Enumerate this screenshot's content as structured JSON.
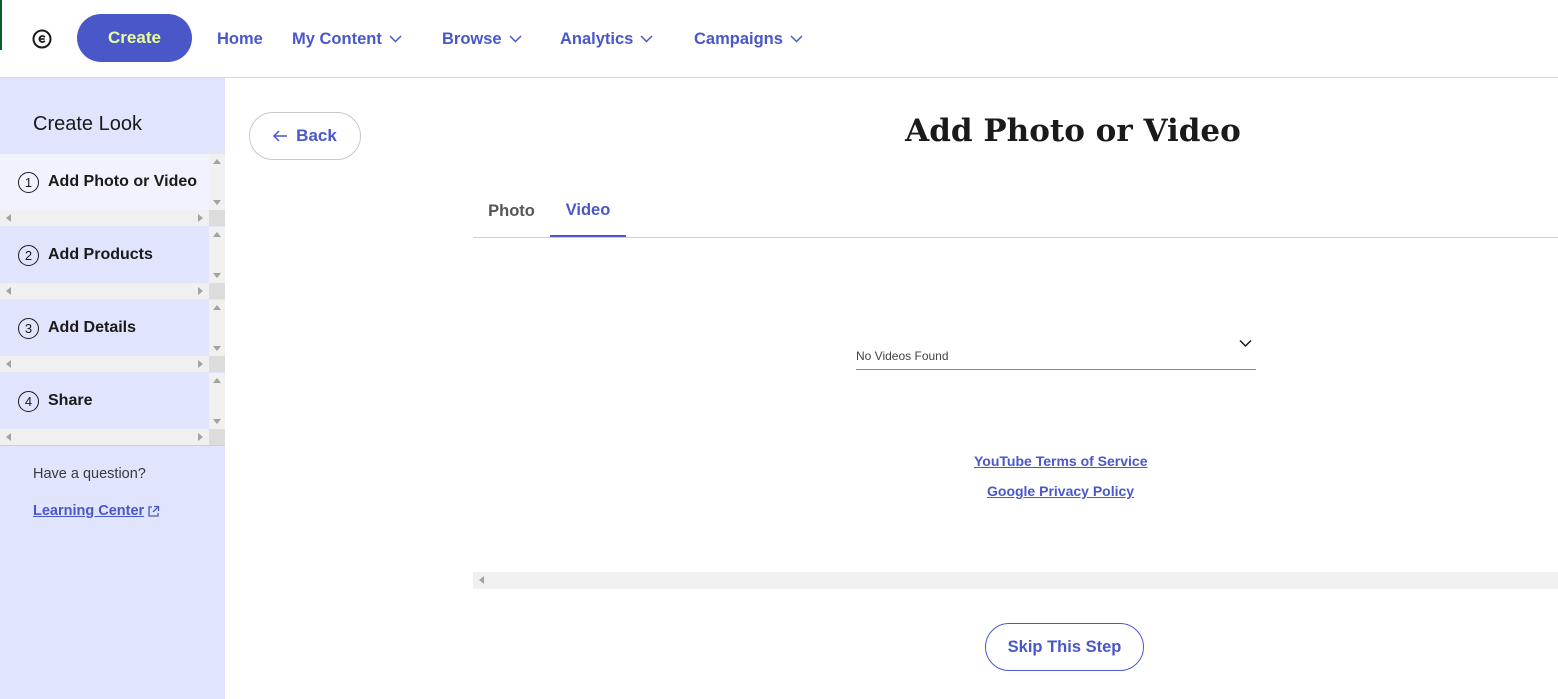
{
  "nav": {
    "create_label": "Create",
    "items": [
      {
        "label": "Home",
        "has_dropdown": false
      },
      {
        "label": "My Content",
        "has_dropdown": true
      },
      {
        "label": "Browse",
        "has_dropdown": true
      },
      {
        "label": "Analytics",
        "has_dropdown": true
      },
      {
        "label": "Campaigns",
        "has_dropdown": true
      }
    ]
  },
  "sidebar": {
    "title": "Create Look",
    "steps": [
      {
        "number": "1",
        "label": "Add Photo or Video",
        "active": true
      },
      {
        "number": "2",
        "label": "Add Products",
        "active": false
      },
      {
        "number": "3",
        "label": "Add Details",
        "active": false
      },
      {
        "number": "4",
        "label": "Share",
        "active": false
      }
    ],
    "question": "Have a question?",
    "learning_center": "Learning Center"
  },
  "main": {
    "back_label": "Back",
    "title": "Add Photo or Video",
    "tabs": [
      {
        "label": "Photo",
        "active": false
      },
      {
        "label": "Video",
        "active": true
      }
    ],
    "video_select": {
      "value": "No Videos Found"
    },
    "links": {
      "youtube_tos": "YouTube Terms of Service",
      "google_privacy": "Google Privacy Policy"
    },
    "skip_label": "Skip This Step"
  },
  "colors": {
    "accent": "#4a57c9",
    "create_text": "#e8ff9c",
    "sidebar_bg": "#e0e4fc",
    "sidebar_active_bg": "#f0f2fe"
  },
  "icons": {
    "logo": "brand-logo-icon",
    "dropdown": "chevron-down-icon",
    "back": "arrow-left-icon",
    "external": "external-link-icon"
  }
}
